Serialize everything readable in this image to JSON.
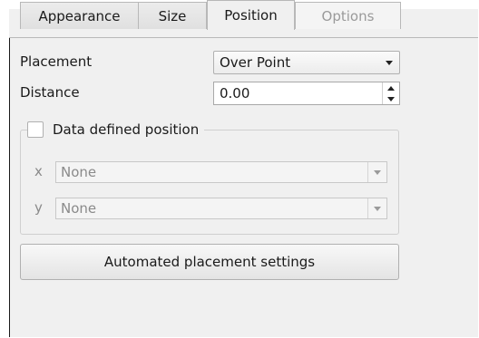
{
  "tabs": [
    {
      "label": "Appearance",
      "state": "normal"
    },
    {
      "label": "Size",
      "state": "normal"
    },
    {
      "label": "Position",
      "state": "active"
    },
    {
      "label": "Options",
      "state": "disabled"
    }
  ],
  "placement": {
    "label": "Placement",
    "value": "Over Point"
  },
  "distance": {
    "label": "Distance",
    "value": "0.00"
  },
  "data_defined": {
    "label": "Data defined position",
    "checked": false,
    "x": {
      "label": "x",
      "value": "None"
    },
    "y": {
      "label": "y",
      "value": "None"
    }
  },
  "automated_button": {
    "label": "Automated placement settings"
  }
}
